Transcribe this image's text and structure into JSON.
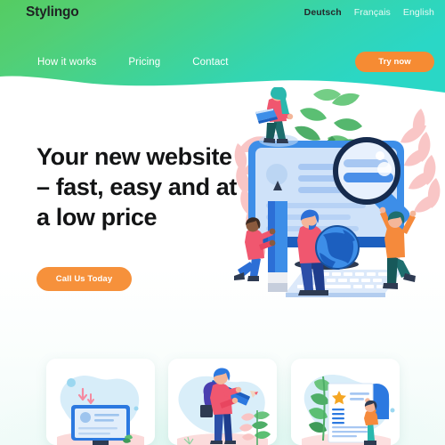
{
  "site": {
    "brand": "Stylingo",
    "accent_green": "#5ECC6E",
    "accent_teal": "#2ED6C0",
    "accent_orange": "#F6913B",
    "heading_color": "#131415"
  },
  "header": {
    "languages": [
      {
        "label": "Deutsch",
        "active": true
      },
      {
        "label": "Français",
        "active": false
      },
      {
        "label": "English",
        "active": false
      }
    ],
    "nav": [
      {
        "label": "How it works"
      },
      {
        "label": "Pricing"
      },
      {
        "label": "Contact"
      }
    ],
    "cta": {
      "label": "Try now"
    }
  },
  "hero": {
    "title": "Your new website – fast, easy and at a low price",
    "cta": {
      "label": "Call Us Today"
    },
    "illustration": {
      "name": "website-building-illustration",
      "elements": [
        "desktop-monitor",
        "magnifying-glass",
        "woman-with-laptop",
        "person-pushing-pencil",
        "man-holding-globe",
        "jumping-person",
        "keyboard",
        "green-leaves",
        "pink-leaves"
      ]
    }
  },
  "cards": [
    {
      "name": "card-monitor",
      "illustration": "monitor-with-content-and-arrow"
    },
    {
      "name": "card-person-pencil",
      "illustration": "person-with-backpack-carrying-pencil"
    },
    {
      "name": "card-certificate",
      "illustration": "document-with-star-and-person"
    }
  ]
}
